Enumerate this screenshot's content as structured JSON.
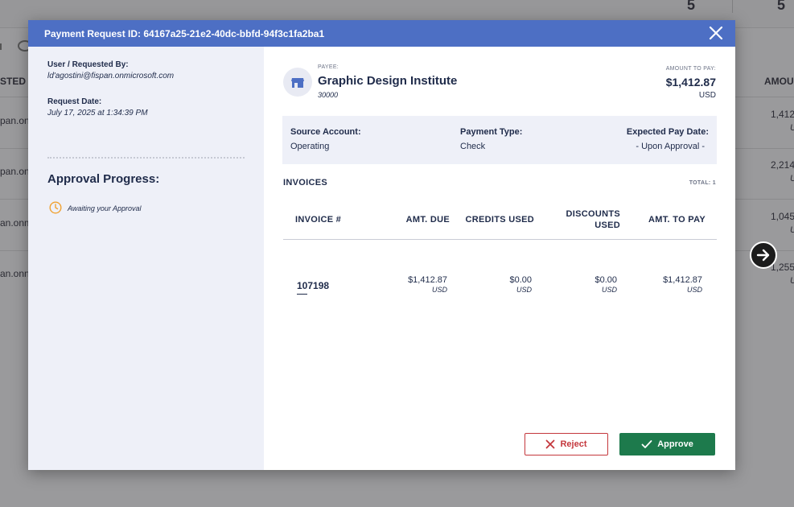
{
  "background": {
    "top_numbers": [
      "5",
      "5"
    ],
    "col_left_header": "STED B",
    "col_right_header": "AMOU",
    "rows": [
      {
        "left": "pan.onn",
        "right": "1,412.",
        "unit": "U"
      },
      {
        "left": "pan.onn",
        "right": "2,214",
        "unit": "U"
      },
      {
        "left": "an.onm",
        "right": "1,045.",
        "unit": "U"
      },
      {
        "left": "an.onn",
        "right": "1,255.",
        "unit": "U"
      }
    ]
  },
  "modal": {
    "title": "Payment Request ID: 64167a25-21e2-40dc-bbfd-94f3c1fa2ba1",
    "requested_by_label": "User / Requested By:",
    "requested_by_value": "ld'agostini@fispan.onmicrosoft.com",
    "request_date_label": "Request Date:",
    "request_date_value": "July 17, 2025 at 1:34:39 PM",
    "approval_progress_label": "Approval Progress:",
    "approval_status": "Awaiting your Approval",
    "payee_caption": "PAYEE:",
    "payee_name": "Graphic Design Institute",
    "payee_id": "30000",
    "amount_caption": "AMOUNT TO PAY:",
    "amount_value": "$1,412.87",
    "amount_currency": "USD",
    "source_account_label": "Source Account:",
    "source_account_value": "Operating",
    "payment_type_label": "Payment Type:",
    "payment_type_value": "Check",
    "expected_pay_date_label": "Expected Pay Date:",
    "expected_pay_date_value": "- Upon Approval -",
    "invoices_title": "INVOICES",
    "invoices_total": "TOTAL: 1",
    "columns": {
      "invoice": "INVOICE #",
      "amt_due": "AMT. DUE",
      "credits": "CREDITS USED",
      "discounts_line1": "DISCOUNTS",
      "discounts_line2": "USED",
      "amt_to_pay": "AMT. TO PAY"
    },
    "invoice_row": {
      "number": "107198",
      "amt_due": "$1,412.87",
      "credits": "$0.00",
      "discounts": "$0.00",
      "amt_to_pay": "$1,412.87",
      "currency": "USD"
    },
    "reject_label": "Reject",
    "approve_label": "Approve"
  },
  "colors": {
    "header_blue": "#4d6fc4",
    "reject_red": "#c4373c",
    "approve_green": "#1d7a4c",
    "clock_orange": "#f0a232"
  }
}
